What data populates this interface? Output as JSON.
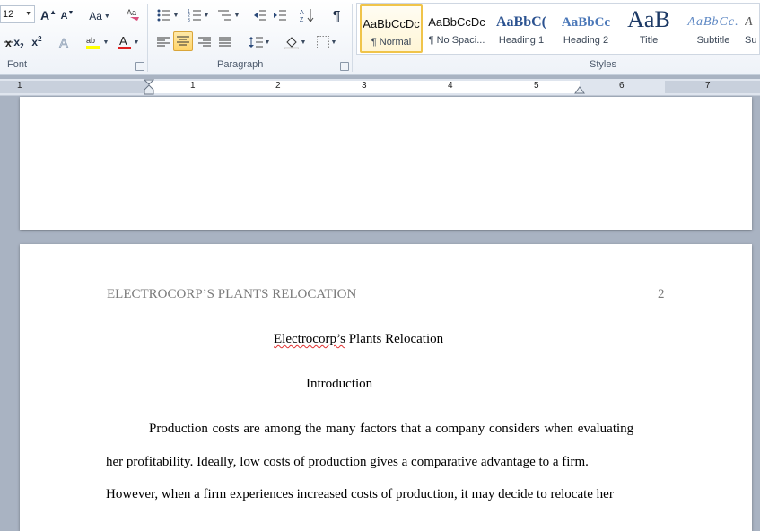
{
  "ribbon": {
    "font_size_value": "12",
    "groups": {
      "font": "Font",
      "paragraph": "Paragraph",
      "styles": "Styles"
    },
    "buttons": {
      "grow_font": "A",
      "shrink_font": "A",
      "change_case": "Aa",
      "subscript": "x",
      "superscript": "x",
      "pilcrow": "¶"
    },
    "styles": [
      {
        "preview": "AaBbCcDc",
        "name": "¶ Normal",
        "selected": true
      },
      {
        "preview": "AaBbCcDc",
        "name": "¶ No Spaci..."
      },
      {
        "preview": "AaBbC(",
        "name": "Heading 1"
      },
      {
        "preview": "AaBbCc",
        "name": "Heading 2"
      },
      {
        "preview": "AaB",
        "name": "Title"
      },
      {
        "preview": "AaBbCc.",
        "name": "Subtitle"
      },
      {
        "preview": "A",
        "name": "Su"
      }
    ],
    "colors": {
      "highlight": "#ffff00",
      "font_color": "#e02020",
      "selected_style": "#f0c44a"
    }
  },
  "ruler": {
    "numbers": [
      "1",
      "1",
      "2",
      "3",
      "4",
      "5",
      "6",
      "7"
    ]
  },
  "document": {
    "running_head": "ELECTROCORP’S PLANTS RELOCATION",
    "page_number": "2",
    "title": "Electrocorp’s Plants Relocation",
    "title_misspelled": "Electrocorp’s",
    "title_rest": " Plants Relocation",
    "section": "Introduction",
    "lines": [
      "Production costs are among the many factors that a company considers when evaluating",
      "her profitability. Ideally, low costs of production gives a comparative advantage to a firm.",
      "However, when a firm experiences increased costs of production, it may decide to relocate her"
    ]
  }
}
